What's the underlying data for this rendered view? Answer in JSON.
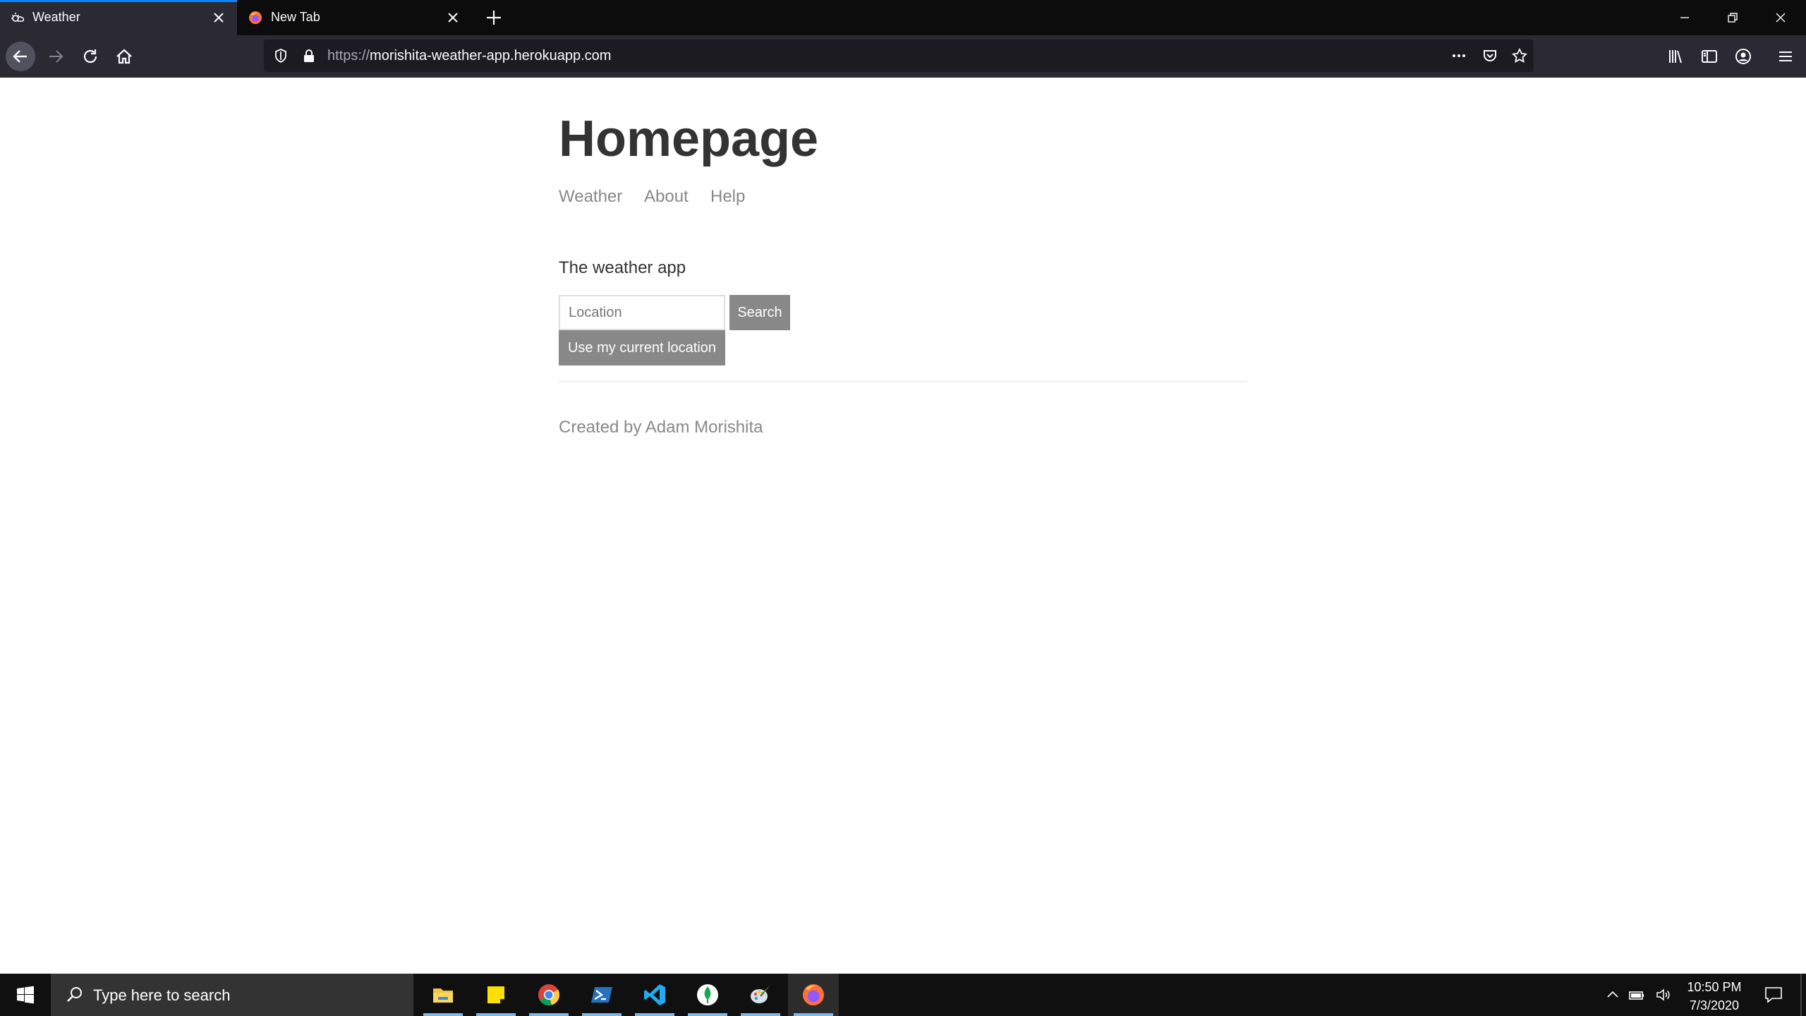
{
  "browser": {
    "tabs": [
      {
        "title": "Weather",
        "active": true
      },
      {
        "title": "New Tab",
        "active": false
      }
    ],
    "url_scheme": "https://",
    "url_host": "morishita-weather-app.herokuapp.com"
  },
  "page": {
    "title": "Homepage",
    "nav": [
      "Weather",
      "About",
      "Help"
    ],
    "intro": "The weather app",
    "location_placeholder": "Location",
    "search_label": "Search",
    "current_location_label": "Use my current location",
    "footer": "Created by Adam Morishita"
  },
  "taskbar": {
    "search_placeholder": "Type here to search",
    "apps": [
      "file-explorer",
      "sticky-notes",
      "chrome",
      "powershell",
      "vscode",
      "mongodb-compass",
      "paint",
      "firefox"
    ],
    "time": "10:50 PM",
    "date": "7/3/2020"
  },
  "colors": {
    "accent": "#0a84ff",
    "button_bg": "#888888",
    "title_text": "#333333",
    "link_text": "#888888"
  }
}
